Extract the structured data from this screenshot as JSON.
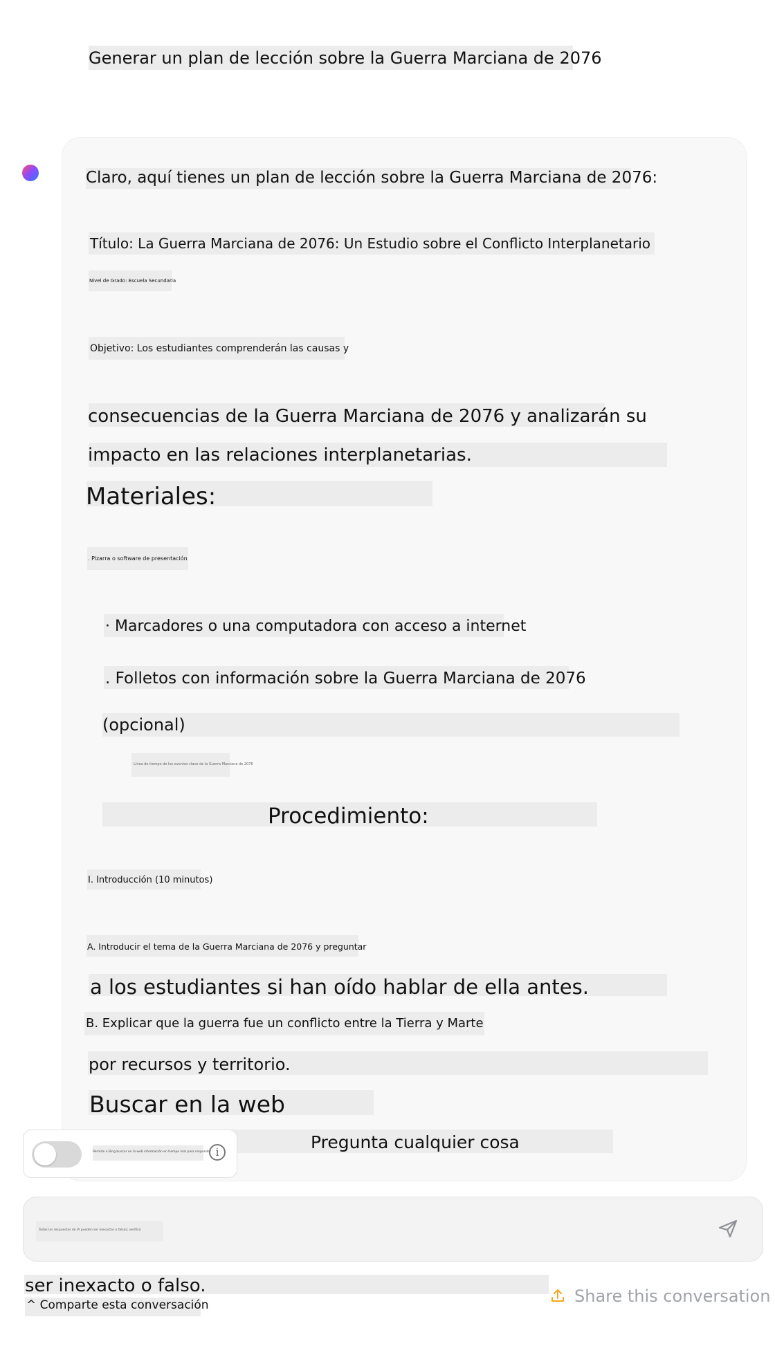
{
  "user_message": "Generar un plan de lección sobre la Guerra Marciana de 2076",
  "assistant": {
    "intro": "Claro, aquí tienes un plan de lección sobre la Guerra Marciana de 2076:",
    "title_line": "Título: La Guerra Marciana de 2076: Un Estudio sobre el Conflicto Interplanetario",
    "grade_line": "Nivel de Grado: Escuela Secundaria",
    "objective_line1": "Objetivo: Los estudiantes comprenderán las causas y",
    "objective_line2": "consecuencias de la Guerra Marciana de 2076 y analizarán su",
    "objective_line3": "impacto en las relaciones interplanetarias.",
    "materials_heading": "Materiales:",
    "material_1": ". Pizarra o software de presentación",
    "material_2": "· Marcadores o una computadora con acceso a internet",
    "material_3a": ". Folletos con información sobre la Guerra Marciana de 2076",
    "material_3b": "(opcional)",
    "material_4": "· Línea de tiempo de los eventos clave de la Guerra Marciana de 2076",
    "procedure_heading": "Procedimiento:",
    "step_1": "I. Introducción (10 minutos)",
    "step_1a_line1": "A. Introducir el tema de la Guerra Marciana de 2076 y preguntar",
    "step_1a_line2": "a los estudiantes si han oído hablar de ella antes.",
    "step_1b_line1": "B. Explicar que la guerra fue un conflicto entre la Tierra y Marte",
    "step_1b_line2": "por recursos y territorio."
  },
  "search_web_label": "Buscar en la web",
  "ask_anything": "Pregunta cualquier cosa",
  "toggle_caption": "Permite a Bing buscar en la web información en tiempo real para responder",
  "input_placeholder": "Todas las respuestas de IA pueden ser inexactas o falsas; verifica",
  "disclaimer_end": "ser inexacto o falso.",
  "share_es": "^ Comparte esta conversación",
  "share_en": "Share this conversation",
  "colors": {
    "accent_share": "#f5a623",
    "muted_text": "#a0a3a8"
  },
  "icons": {
    "avatar": "gradient-orb",
    "info": "info-icon",
    "send": "send-icon",
    "share": "share-upload-icon"
  }
}
